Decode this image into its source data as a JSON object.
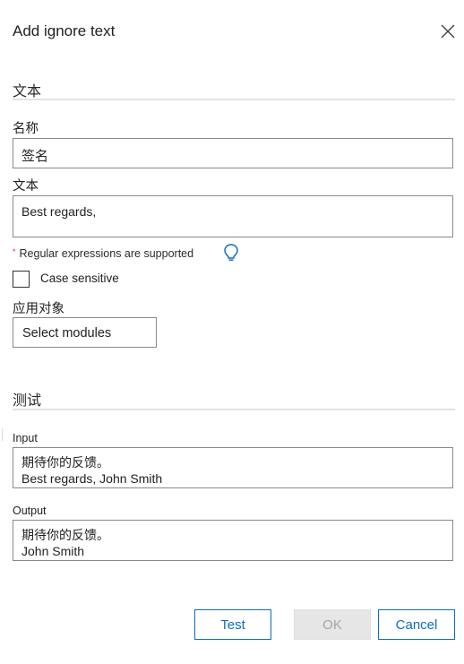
{
  "dialog": {
    "title": "Add ignore text",
    "close_icon": "close-icon"
  },
  "text_section": {
    "heading": "文本",
    "name_label": "名称",
    "name_value": "签名",
    "text_label": "文本",
    "text_value": "Best regards,",
    "hint_marker": "*",
    "hint": "Regular expressions are supported",
    "hint_icon": "lightbulb-icon",
    "case_sensitive_label": "Case sensitive",
    "case_sensitive_checked": false,
    "apply_to_label": "应用对象",
    "apply_to_value": "Select modules"
  },
  "test_section": {
    "heading": "测试",
    "input_label": "Input",
    "input_lines": [
      "期待你的反馈。",
      "Best regards, John Smith"
    ],
    "output_label": "Output",
    "output_lines": [
      "期待你的反馈。",
      "John Smith"
    ]
  },
  "buttons": {
    "test": "Test",
    "ok": "OK",
    "ok_enabled": false,
    "cancel": "Cancel"
  },
  "colors": {
    "accent": "#0f6cbd",
    "border": "#8a8a8a",
    "divider": "#e3e3e3",
    "disabled_bg": "#e6e6e6",
    "hint_marker": "#d13438"
  }
}
